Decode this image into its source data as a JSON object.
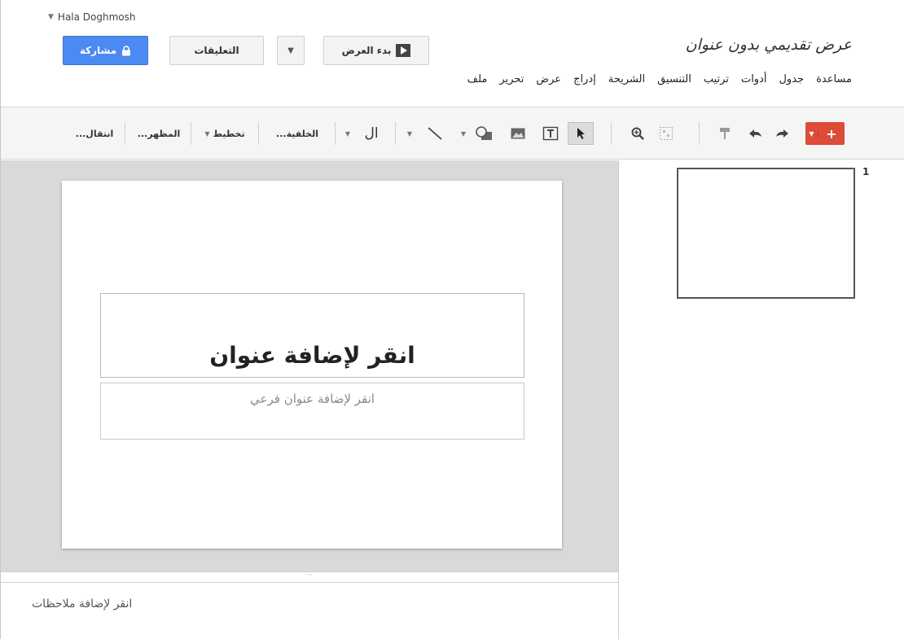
{
  "account": {
    "name": "Hala Doghmosh"
  },
  "document": {
    "title": "عرض تقديمي بدون عنوان"
  },
  "menu": [
    "ملف",
    "تحرير",
    "عرض",
    "إدراج",
    "الشريحة",
    "التنسيق",
    "ترتيب",
    "أدوات",
    "جدول",
    "مساعدة"
  ],
  "buttons": {
    "share": "مشاركة",
    "comments": "التعليقات",
    "present": "بدء العرض"
  },
  "toolbar": {
    "add": "+",
    "transition": "انتقال...",
    "theme": "المظهر...",
    "layout": "تخطيط",
    "background": "الخلفية...",
    "line_label": "ال"
  },
  "slide": {
    "title_placeholder": "انقر لإضافة عنوان",
    "subtitle_placeholder": "انقر لإضافة عنوان فرعي"
  },
  "notes": {
    "placeholder": "انقر لإضافة ملاحظات"
  },
  "filmstrip": {
    "slide_number": "1"
  },
  "colors": {
    "share": "#4b8af2",
    "add": "#dd4b39",
    "canvas_bg": "#d9d9d9"
  },
  "icons": [
    "lock-icon",
    "play-icon",
    "undo-icon",
    "redo-icon",
    "paint-format-icon",
    "zoom-icon",
    "select-icon",
    "textbox-icon",
    "image-icon",
    "shape-icon",
    "line-icon",
    "select-all-icon",
    "chevron-down-icon"
  ]
}
